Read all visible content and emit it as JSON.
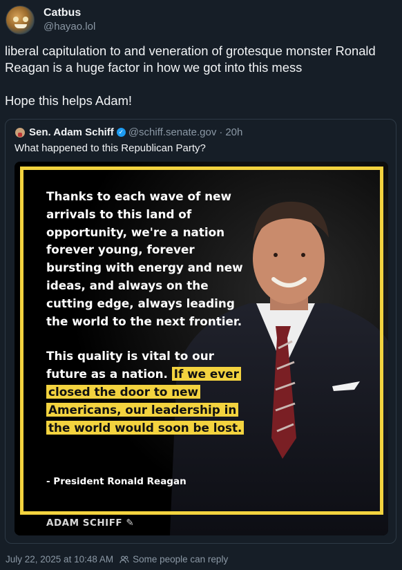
{
  "author": {
    "display_name": "Catbus",
    "handle": "@hayao.lol",
    "avatar_icon": "catbus-avatar-icon"
  },
  "post": {
    "line1": "liberal capitulation to and veneration of grotesque monster Ronald Reagan is a huge factor in how we got into this mess",
    "line2": "Hope this helps Adam!"
  },
  "quoted_post": {
    "display_name": "Sen. Adam Schiff",
    "handle": "@schiff.senate.gov",
    "separator": "·",
    "time": "20h",
    "text": "What happened to this Republican Party?",
    "verified_icon": "verified-badge-icon",
    "image": {
      "quote_para1": "Thanks to each wave of new arrivals to this land of opportunity, we're a nation forever young, forever bursting with energy and new ideas, and always on the cutting edge, always leading the world to the next frontier.",
      "quote_para2_plain": "This quality is vital to our future as a nation.",
      "quote_para2_highlight": "If we ever closed the door to new Americans, our leadership in the world would soon be lost.",
      "attribution": "- President Ronald Reagan",
      "brand": "ADAM SCHIFF",
      "accent_color": "#f3d33f"
    }
  },
  "footer": {
    "timestamp": "July 22, 2025 at 10:48 AM",
    "reply_setting": "Some people can reply",
    "reply_icon": "people-icon"
  }
}
